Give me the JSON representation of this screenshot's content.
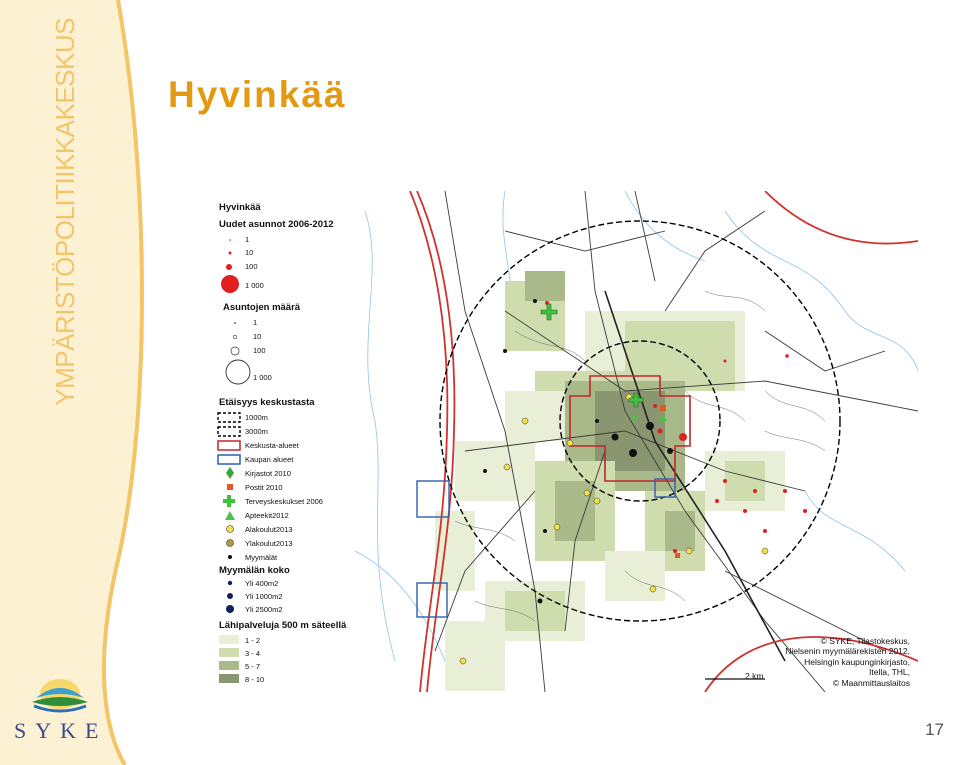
{
  "slide": {
    "vertical_title": "YMPÄRISTÖPOLITIIKKAKESKUS",
    "title": "Hyvinkää",
    "page_number": "17",
    "logo_text": "SYKE",
    "accent_color": "#e39a12",
    "band_color": "#fdf1d4"
  },
  "legend": {
    "map_title": "Hyvinkää",
    "new_dwellings_title": "Uudet asunnot 2006-2012",
    "new_dwellings_items": [
      "1",
      "10",
      "100",
      "1 000"
    ],
    "dwellings_count_title": "Asuntojen määrä",
    "dwellings_count_items": [
      "1",
      "10",
      "100",
      "1 000"
    ],
    "distance_title": "Etäisyys keskustasta",
    "distance_items": [
      "1000m",
      "3000m",
      "Keskusta-alueet",
      "Kaupan alueet",
      "Kirjastot 2010",
      "Postit 2010",
      "Terveyskeskukset 2006",
      "Apteekit2012",
      "Alakoulut2013",
      "Ylakoulut2013",
      "Myymälät"
    ],
    "store_size_title": "Myymälän koko",
    "store_size_items": [
      "Yli 400m2",
      "Yli 1000m2",
      "Yli 2500m2"
    ],
    "services_title": "Lähipalveluja 500 m säteellä",
    "services_items": [
      "1 - 2",
      "3 - 4",
      "5 - 7",
      "8 - 10"
    ]
  },
  "map": {
    "scale_label": "2 km",
    "copyright_lines": [
      "© SYKE, Tilastokeskus,",
      "Nielsenin myymälärekisteri 2012,",
      "Helsingin kaupunginkirjasto,",
      "Itella, THL,",
      "© Maanmittauslaitos"
    ],
    "colors": {
      "services_1_2": "#e9efd6",
      "services_3_4": "#cfdcae",
      "services_5_7": "#a9b98a",
      "services_8_10": "#8a9670",
      "center_area": "#c0272d",
      "retail_area": "#2f5fb0",
      "new_dwellings": "#e02020",
      "library": "#3aa63a",
      "post": "#e35a1f",
      "health_center": "#3cc23c",
      "pharmacy": "#4cc24c",
      "primary_school": "#f4e04a",
      "secondary_school": "#b39a3a",
      "store": "#111111"
    }
  }
}
